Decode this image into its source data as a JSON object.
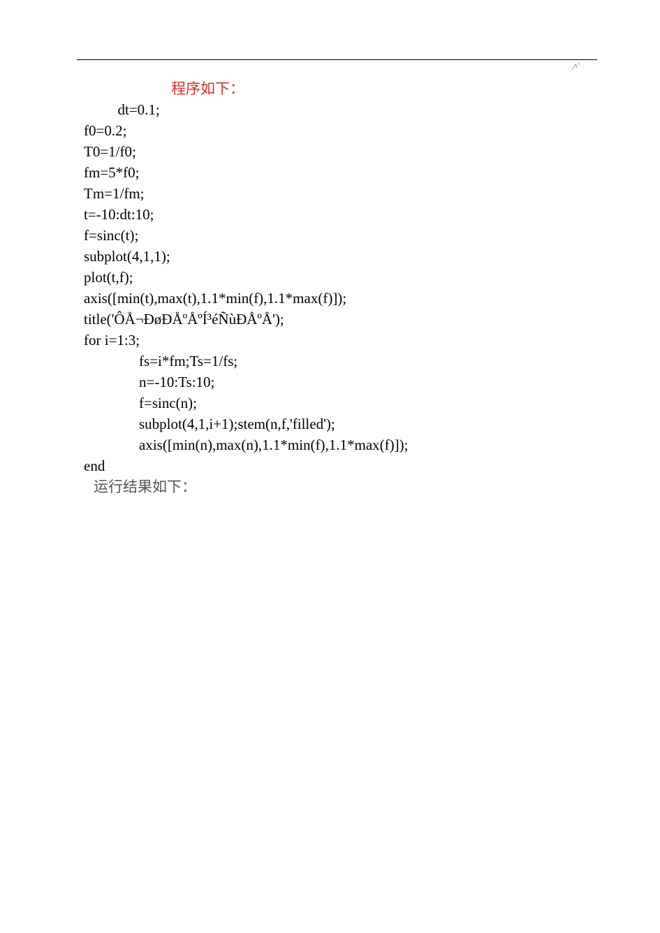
{
  "marker": ".^`",
  "header_text": "程序如下：",
  "lines": [
    "  dt=0.1;",
    "f0=0.2;",
    "T0=1/f0;",
    "fm=5*f0;",
    "Tm=1/fm;",
    "t=-10:dt:10;",
    "f=sinc(t);",
    "subplot(4,1,1);",
    "plot(t,f);",
    "axis([min(t),max(t),1.1*min(f),1.1*max(f)]);",
    "title('ÔÅ¬ÐøÐÅºÅºÍ³éÑùÐÅºÅ');",
    "for i=1:3;",
    "    fs=i*fm;Ts=1/fs;",
    "    n=-10:Ts:10;",
    "    f=sinc(n);",
    "    subplot(4,1,i+1);stem(n,f,'filled');",
    "    axis([min(n),max(n),1.1*min(f),1.1*max(f)]);",
    "end"
  ],
  "result_text": "运行结果如下："
}
